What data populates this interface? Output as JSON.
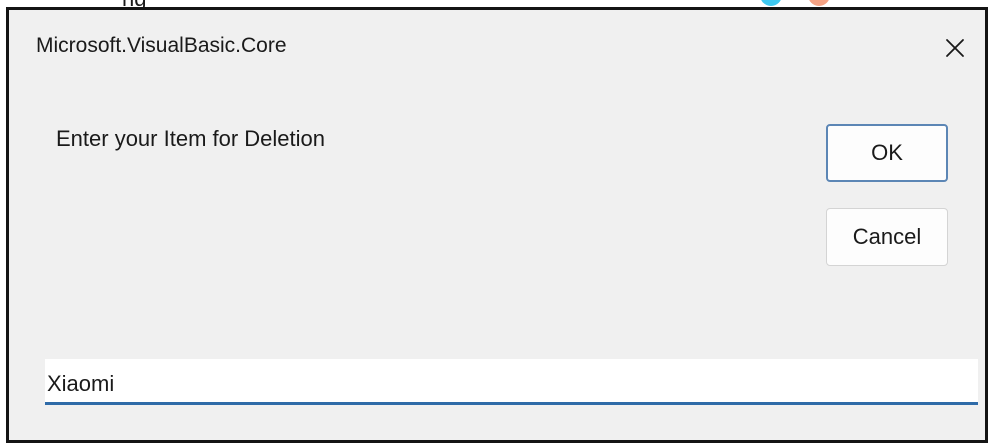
{
  "dialog": {
    "title": "Microsoft.VisualBasic.Core",
    "close_icon": "close-icon",
    "prompt": "Enter your Item for Deletion",
    "ok_label": "OK",
    "cancel_label": "Cancel",
    "input_value": "Xiaomi"
  },
  "top_strip": {
    "cropped_text": "ng"
  },
  "colors": {
    "dialog_background": "#f0f0f0",
    "dialog_border": "#141414",
    "ok_button_border": "#5c86b5",
    "input_underline": "#2f6ba8",
    "cropped_dot_cyan": "#3ec8f0",
    "cropped_dot_orange": "#f4a284"
  }
}
